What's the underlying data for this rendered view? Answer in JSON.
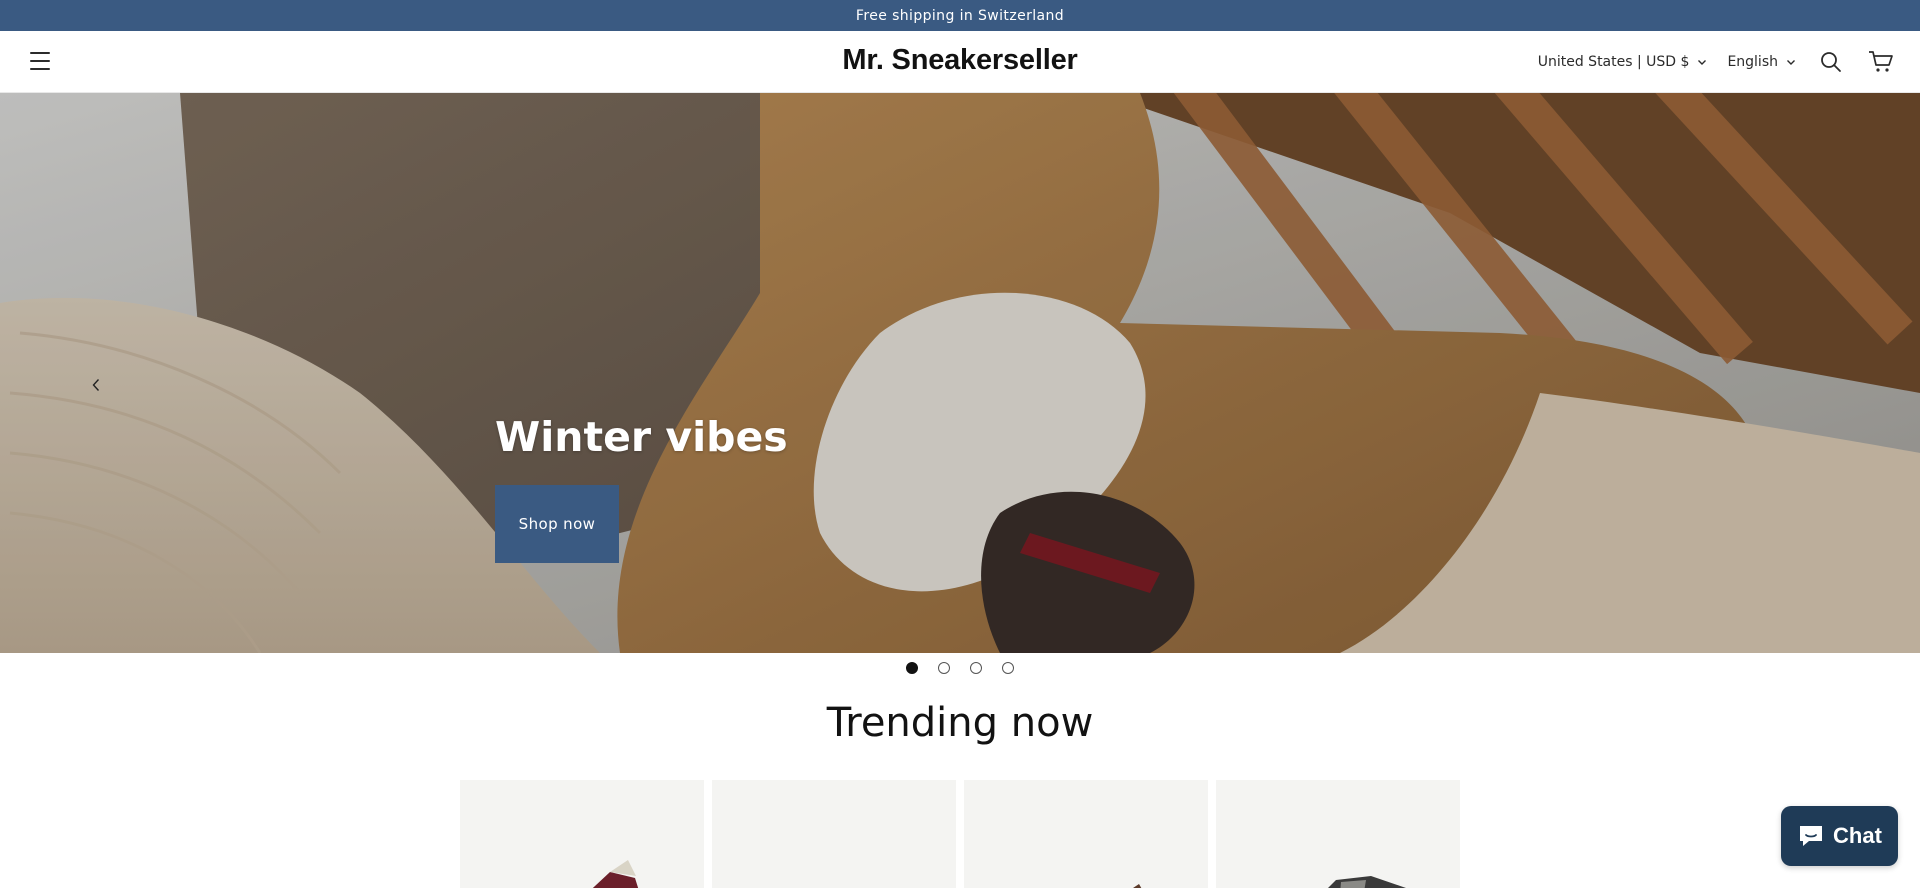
{
  "announcement": {
    "text": "Free shipping in Switzerland"
  },
  "header": {
    "logo": "Mr. Sneakerseller",
    "country": "United States | USD $",
    "language": "English",
    "icons": {
      "menu": "hamburger-menu-icon",
      "search": "search-icon",
      "cart": "cart-icon"
    }
  },
  "hero": {
    "title": "Winter vibes",
    "button": "Shop now",
    "slides_total": 4,
    "active_slide": 1
  },
  "trending": {
    "title": "Trending now",
    "products_visible": 4
  },
  "chat": {
    "label": "Chat"
  },
  "colors": {
    "brand": "#3a5a82",
    "chat": "#1f3b57",
    "text": "#121212"
  }
}
